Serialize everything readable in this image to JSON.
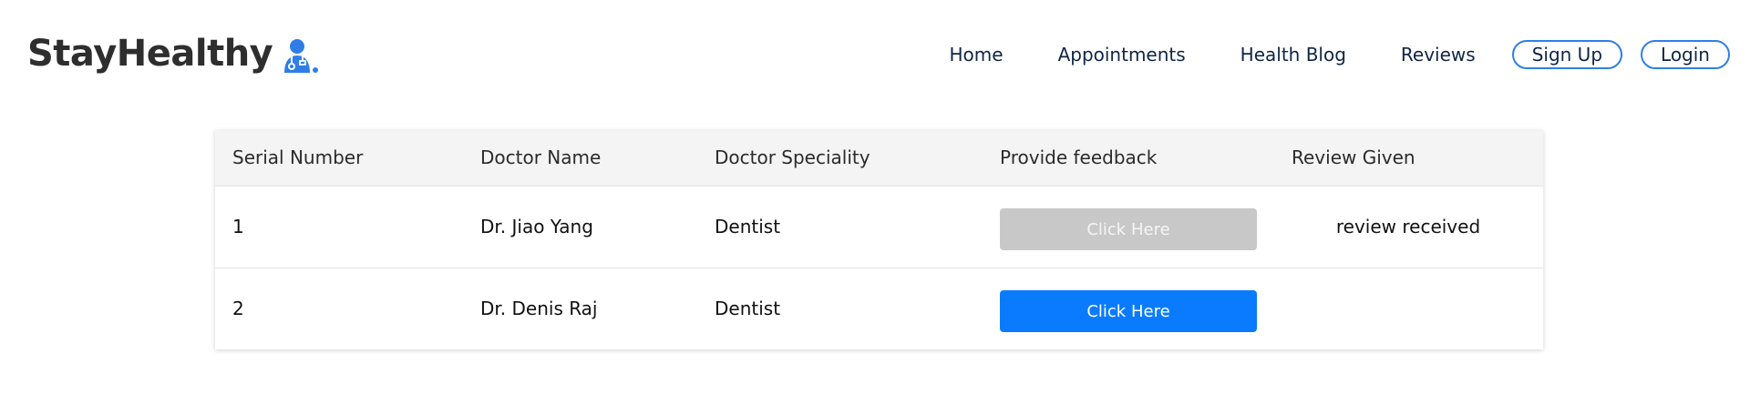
{
  "brand": {
    "name": "StayHealthy",
    "icon": "doctor-icon",
    "icon_color": "#2f7ee6"
  },
  "nav": {
    "links": [
      "Home",
      "Appointments",
      "Health Blog",
      "Reviews"
    ],
    "signup_label": "Sign Up",
    "login_label": "Login"
  },
  "table": {
    "headers": [
      "Serial Number",
      "Doctor Name",
      "Doctor Speciality",
      "Provide feedback",
      "Review Given"
    ],
    "rows": [
      {
        "serial": "1",
        "doctor_name": "Dr. Jiao Yang",
        "speciality": "Dentist",
        "button_label": "Click Here",
        "button_state": "disabled",
        "review": "review received"
      },
      {
        "serial": "2",
        "doctor_name": "Dr. Denis Raj",
        "speciality": "Dentist",
        "button_label": "Click Here",
        "button_state": "active",
        "review": ""
      }
    ]
  },
  "colors": {
    "accent": "#0a7bff",
    "disabled_button": "#c8c8c8",
    "header_bg": "#f4f4f4",
    "nav_text": "#0f2545"
  }
}
